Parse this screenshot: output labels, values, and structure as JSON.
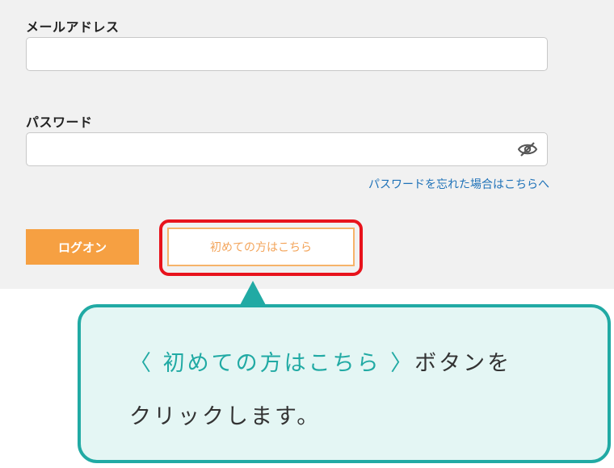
{
  "login_form": {
    "email_label": "メールアドレス",
    "email_value": "",
    "password_label": "パスワード",
    "password_value": "",
    "password_toggle_icon": "eye-slash-icon",
    "forgot_password_link": "パスワードを忘れた場合はこちらへ",
    "login_button": "ログオン",
    "first_time_button": "初めての方はこちら"
  },
  "annotation": {
    "highlight_color": "#e8131c",
    "callout_highlight_text": "〈 初めての方はこちら 〉",
    "callout_text_rest": "ボタンを",
    "callout_line2": "クリックします。",
    "callout_border_color": "#21aaa4",
    "callout_bg_color": "#e4f6f4"
  },
  "colors": {
    "panel_bg": "#f1f1f1",
    "login_button_bg": "#f6a042",
    "first_time_button_text": "#f3a45a",
    "link": "#1f72b8"
  }
}
